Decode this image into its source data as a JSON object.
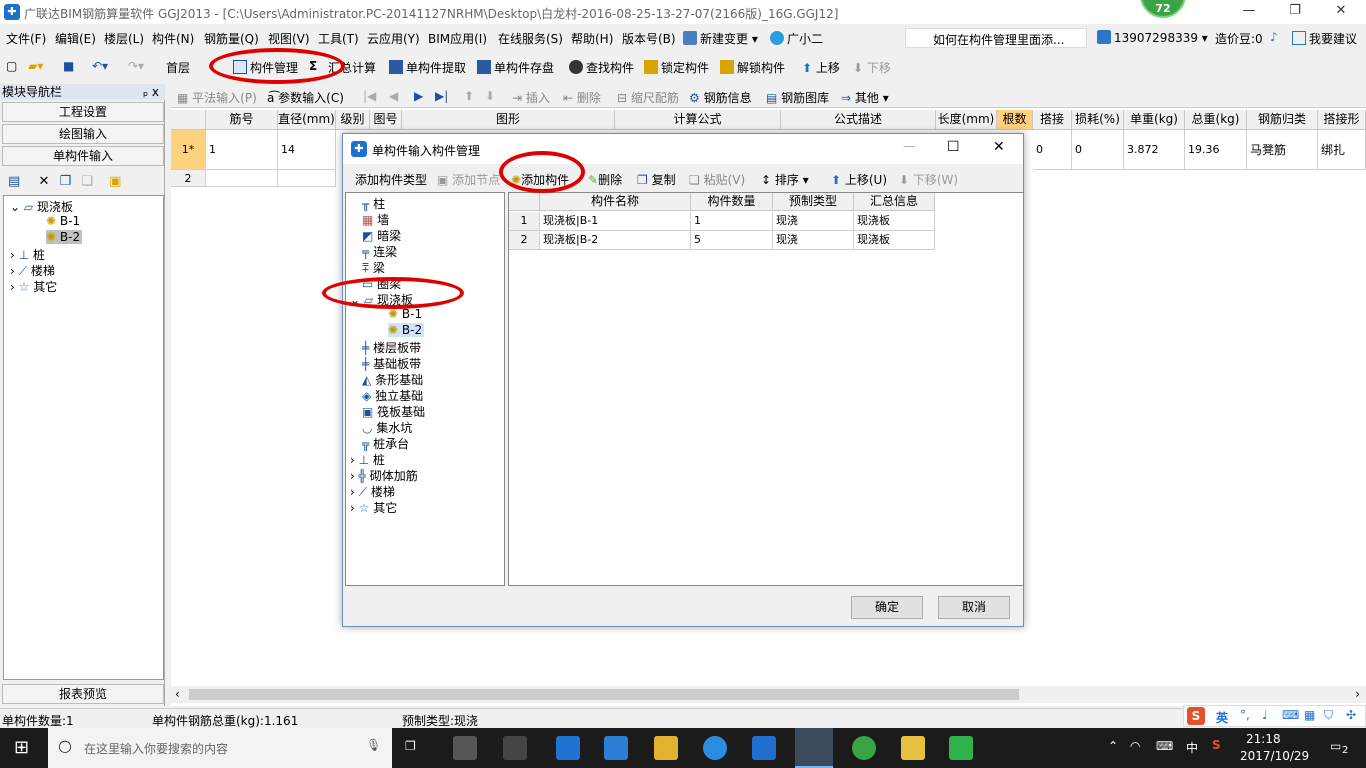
{
  "window": {
    "title": "广联达BIM钢筋算量软件 GGJ2013 - [C:\\Users\\Administrator.PC-20141127NRHM\\Desktop\\白龙村-2016-08-25-13-27-07(2166版)_16G.GGJ12]",
    "badge": "72"
  },
  "menu": {
    "items": [
      "文件(F)",
      "编辑(E)",
      "楼层(L)",
      "构件(N)",
      "钢筋量(Q)",
      "视图(V)",
      "工具(T)",
      "云应用(Y)",
      "BIM应用(I)",
      "在线服务(S)",
      "帮助(H)",
      "版本号(B)",
      "新建变更",
      "广小二"
    ],
    "hint": "如何在构件管理里面添...",
    "phone": "13907298339",
    "price": "造价豆:0",
    "suggest": "我要建议"
  },
  "toolbar": {
    "floor": "首层",
    "manage": "构件管理",
    "sum_icon": "Σ",
    "calc": "汇总计算",
    "extract": "单构件提取",
    "store": "单构件存盘",
    "find": "查找构件",
    "lock": "锁定构件",
    "unlock": "解锁构件",
    "up": "上移",
    "down": "下移"
  },
  "nav": {
    "header": "模块导航栏",
    "pin": "ₚ x",
    "buttons": [
      "工程设置",
      "绘图输入",
      "单构件输入"
    ],
    "report": "报表预览",
    "tree": [
      "现浇板",
      "B-1",
      "B-2",
      "桩",
      "楼梯",
      "其它"
    ]
  },
  "toolbar2": {
    "flat": "平法输入(P)",
    "param": "参数输入(C)",
    "insert": "插入",
    "delete": "删除",
    "scale": "缩尺配筋",
    "info": "钢筋信息",
    "lib": "钢筋图库",
    "other": "其他"
  },
  "grid": {
    "headers": [
      "",
      "筋号",
      "直径(mm)",
      "级别",
      "图号",
      "图形",
      "计算公式",
      "公式描述",
      "长度(mm)",
      "根数",
      "搭接",
      "损耗(%)",
      "单重(kg)",
      "总重(kg)",
      "钢筋归类",
      "搭接形"
    ],
    "rows": [
      {
        "idx": "1*",
        "no": "1",
        "dia": "14",
        "lap": "0",
        "loss": "0",
        "unit": "3.872",
        "total": "19.36",
        "cat": "马凳筋",
        "form": "绑扎"
      },
      {
        "idx": "2"
      }
    ]
  },
  "status": {
    "count": "单构件数量:1",
    "weight": "单构件钢筋总重(kg):1.161",
    "type": "预制类型:现浇"
  },
  "dialog": {
    "title": "单构件输入构件管理",
    "add_type": "添加构件类型",
    "add_node": "添加节点",
    "add_comp": "添加构件",
    "delete": "删除",
    "copy": "复制",
    "paste": "粘贴(V)",
    "sort": "排序",
    "up": "上移(U)",
    "down": "下移(W)",
    "ok": "确定",
    "cancel": "取消",
    "tree": [
      "柱",
      "墙",
      "暗梁",
      "连梁",
      "梁",
      "圈梁",
      "现浇板",
      "B-1",
      "B-2",
      "楼层板带",
      "基础板带",
      "条形基础",
      "独立基础",
      "筏板基础",
      "集水坑",
      "桩承台",
      "桩",
      "砌体加筋",
      "楼梯",
      "其它"
    ],
    "headers": [
      "",
      "构件名称",
      "构件数量",
      "预制类型",
      "汇总信息"
    ],
    "rows": [
      {
        "n": "1",
        "name": "现浇板|B-1",
        "qty": "1",
        "type": "现浇",
        "sum": "现浇板"
      },
      {
        "n": "2",
        "name": "现浇板|B-2",
        "qty": "5",
        "type": "现浇",
        "sum": "现浇板"
      }
    ]
  },
  "taskbar": {
    "search": "在这里输入你要搜索的内容",
    "ime": "中",
    "time": "21:18",
    "date": "2017/10/29",
    "tray_lang": "英",
    "notify": "2"
  },
  "colors": {
    "accent": "#1f6fd1",
    "annotation": "#e00000",
    "highlight": "#ffd27f"
  }
}
